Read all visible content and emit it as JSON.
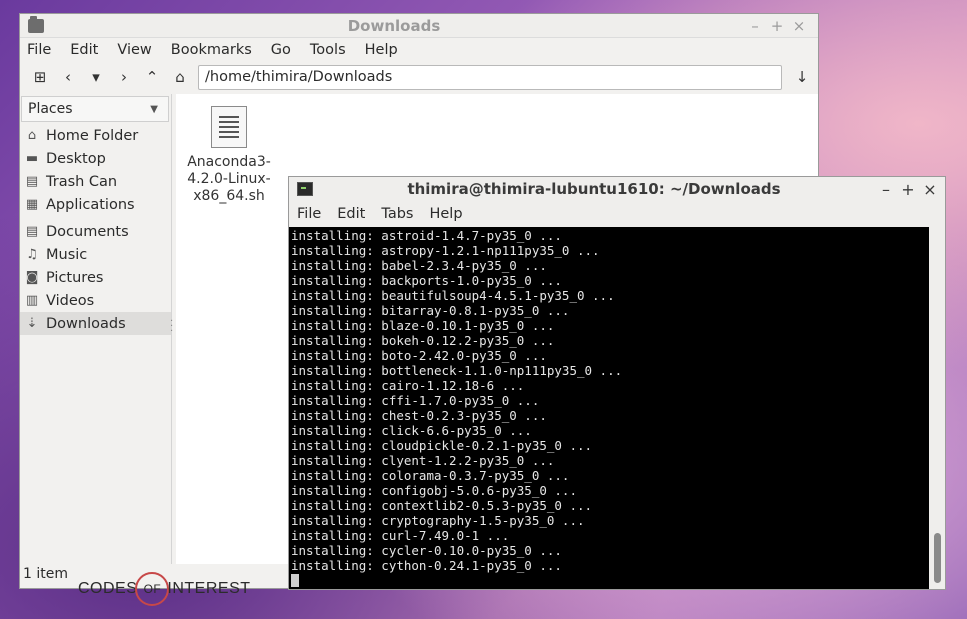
{
  "file_manager": {
    "title": "Downloads",
    "menu": [
      "File",
      "Edit",
      "View",
      "Bookmarks",
      "Go",
      "Tools",
      "Help"
    ],
    "path": "/home/thimira/Downloads",
    "places_label": "Places",
    "places": [
      {
        "label": "Home Folder",
        "icon": "home-icon"
      },
      {
        "label": "Desktop",
        "icon": "desktop-icon"
      },
      {
        "label": "Trash Can",
        "icon": "trash-icon"
      },
      {
        "label": "Applications",
        "icon": "applications-icon"
      }
    ],
    "bookmarks": [
      {
        "label": "Documents",
        "icon": "documents-icon"
      },
      {
        "label": "Music",
        "icon": "music-icon"
      },
      {
        "label": "Pictures",
        "icon": "pictures-icon"
      },
      {
        "label": "Videos",
        "icon": "videos-icon"
      },
      {
        "label": "Downloads",
        "icon": "downloads-icon"
      }
    ],
    "file": {
      "name_l1": "Anaconda3-",
      "name_l2": "4.2.0-Linux-",
      "name_l3": "x86_64.sh"
    },
    "status": "1 item"
  },
  "terminal": {
    "title": "thimira@thimira-lubuntu1610: ~/Downloads",
    "menu": [
      "File",
      "Edit",
      "Tabs",
      "Help"
    ],
    "lines": [
      "installing: astroid-1.4.7-py35_0 ...",
      "installing: astropy-1.2.1-np111py35_0 ...",
      "installing: babel-2.3.4-py35_0 ...",
      "installing: backports-1.0-py35_0 ...",
      "installing: beautifulsoup4-4.5.1-py35_0 ...",
      "installing: bitarray-0.8.1-py35_0 ...",
      "installing: blaze-0.10.1-py35_0 ...",
      "installing: bokeh-0.12.2-py35_0 ...",
      "installing: boto-2.42.0-py35_0 ...",
      "installing: bottleneck-1.1.0-np111py35_0 ...",
      "installing: cairo-1.12.18-6 ...",
      "installing: cffi-1.7.0-py35_0 ...",
      "installing: chest-0.2.3-py35_0 ...",
      "installing: click-6.6-py35_0 ...",
      "installing: cloudpickle-0.2.1-py35_0 ...",
      "installing: clyent-1.2.2-py35_0 ...",
      "installing: colorama-0.3.7-py35_0 ...",
      "installing: configobj-5.0.6-py35_0 ...",
      "installing: contextlib2-0.5.3-py35_0 ...",
      "installing: cryptography-1.5-py35_0 ...",
      "installing: curl-7.49.0-1 ...",
      "installing: cycler-0.10.0-py35_0 ...",
      "installing: cython-0.24.1-py35_0 ..."
    ]
  },
  "watermark": {
    "left": "CODES",
    "of": "OF",
    "right": "INTEREST"
  },
  "colors": {
    "accent_circle": "#c74848",
    "terminal_bg": "#000000"
  }
}
